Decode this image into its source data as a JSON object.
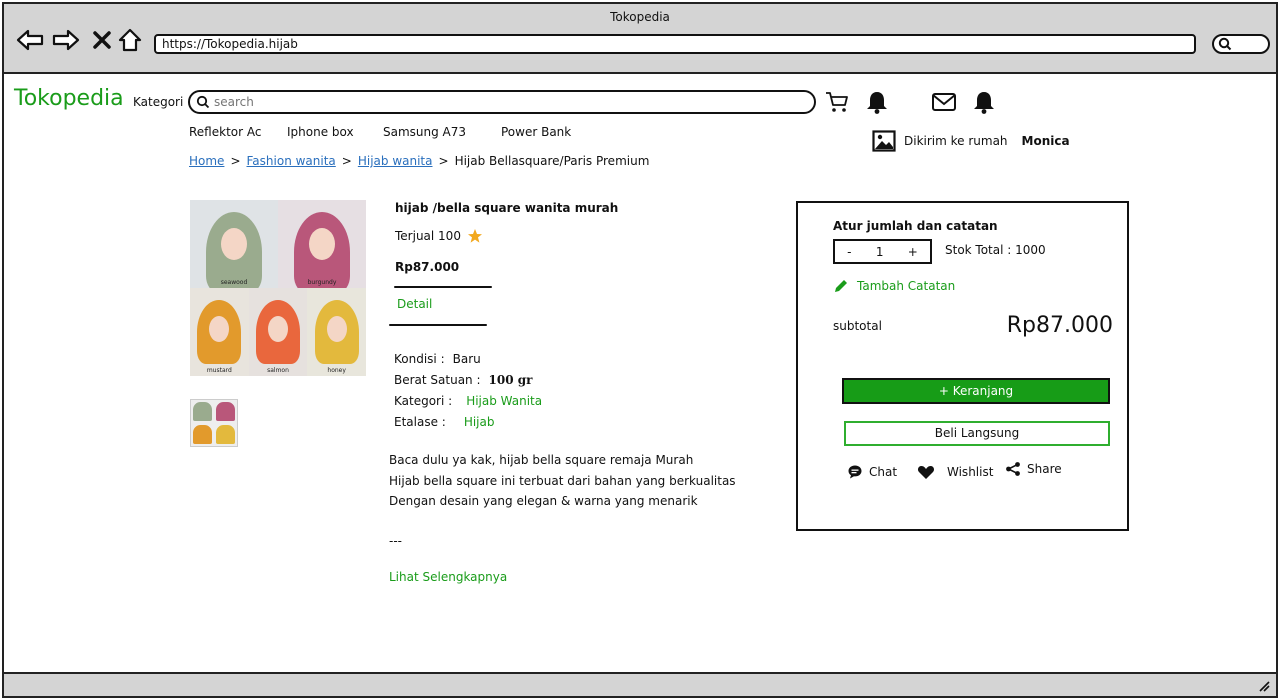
{
  "browser": {
    "window_title": "Tokopedia",
    "url": "https://Tokopedia.hijab"
  },
  "header": {
    "logo": "Tokopedia",
    "kategori": "Kategori",
    "search_placeholder": "search"
  },
  "quick_links": [
    "Reflektor Ac",
    "Iphone box",
    "Samsung A73",
    "Power Bank"
  ],
  "shipping": {
    "label": "Dikirim ke rumah",
    "name": "Monica"
  },
  "breadcrumb": {
    "home": "Home",
    "cat1": "Fashion wanita",
    "cat2": "Hijab wanita",
    "current": "Hijab Bellasquare/Paris Premium",
    "separator": ">"
  },
  "gallery": {
    "variants": [
      "seawood",
      "burgundy",
      "mustard",
      "salmon",
      "honey"
    ],
    "colors": [
      "#9aab8e",
      "#b9577a",
      "#e29a2c",
      "#e9673d",
      "#e3b93d"
    ]
  },
  "product": {
    "title": "hijab /bella square wanita murah",
    "sold": "Terjual 100",
    "price": "Rp87.000",
    "detail_tab": "Detail",
    "specs": {
      "kondisi_label": "Kondisi :",
      "kondisi_value": "Baru",
      "berat_label": "Berat Satuan :",
      "berat_value": "100 gr",
      "kategori_label": "Kategori :",
      "kategori_value": "Hijab Wanita",
      "etalase_label": "Etalase :",
      "etalase_value": "Hijab"
    },
    "description": [
      "Baca dulu ya kak, hijab bella square remaja Murah",
      "Hijab bella square ini terbuat dari bahan yang berkualitas",
      "Dengan desain yang elegan & warna yang menarik"
    ],
    "dashes": "---",
    "more": "Lihat Selengkapnya"
  },
  "order": {
    "title": "Atur jumlah dan catatan",
    "minus": "-",
    "qty": "1",
    "plus": "+",
    "stock": "Stok Total : 1000",
    "note": "Tambah Catatan",
    "subtotal_label": "subtotal",
    "subtotal_value": "Rp87.000",
    "cart_button": "+ Keranjang",
    "buy_button": "Beli Langsung",
    "chat": "Chat",
    "wishlist": "Wishlist",
    "share": "Share"
  },
  "colors": {
    "brand_green": "#1a9c1a",
    "link_blue": "#2a6fbd",
    "frame_gray": "#d4d4d4"
  }
}
